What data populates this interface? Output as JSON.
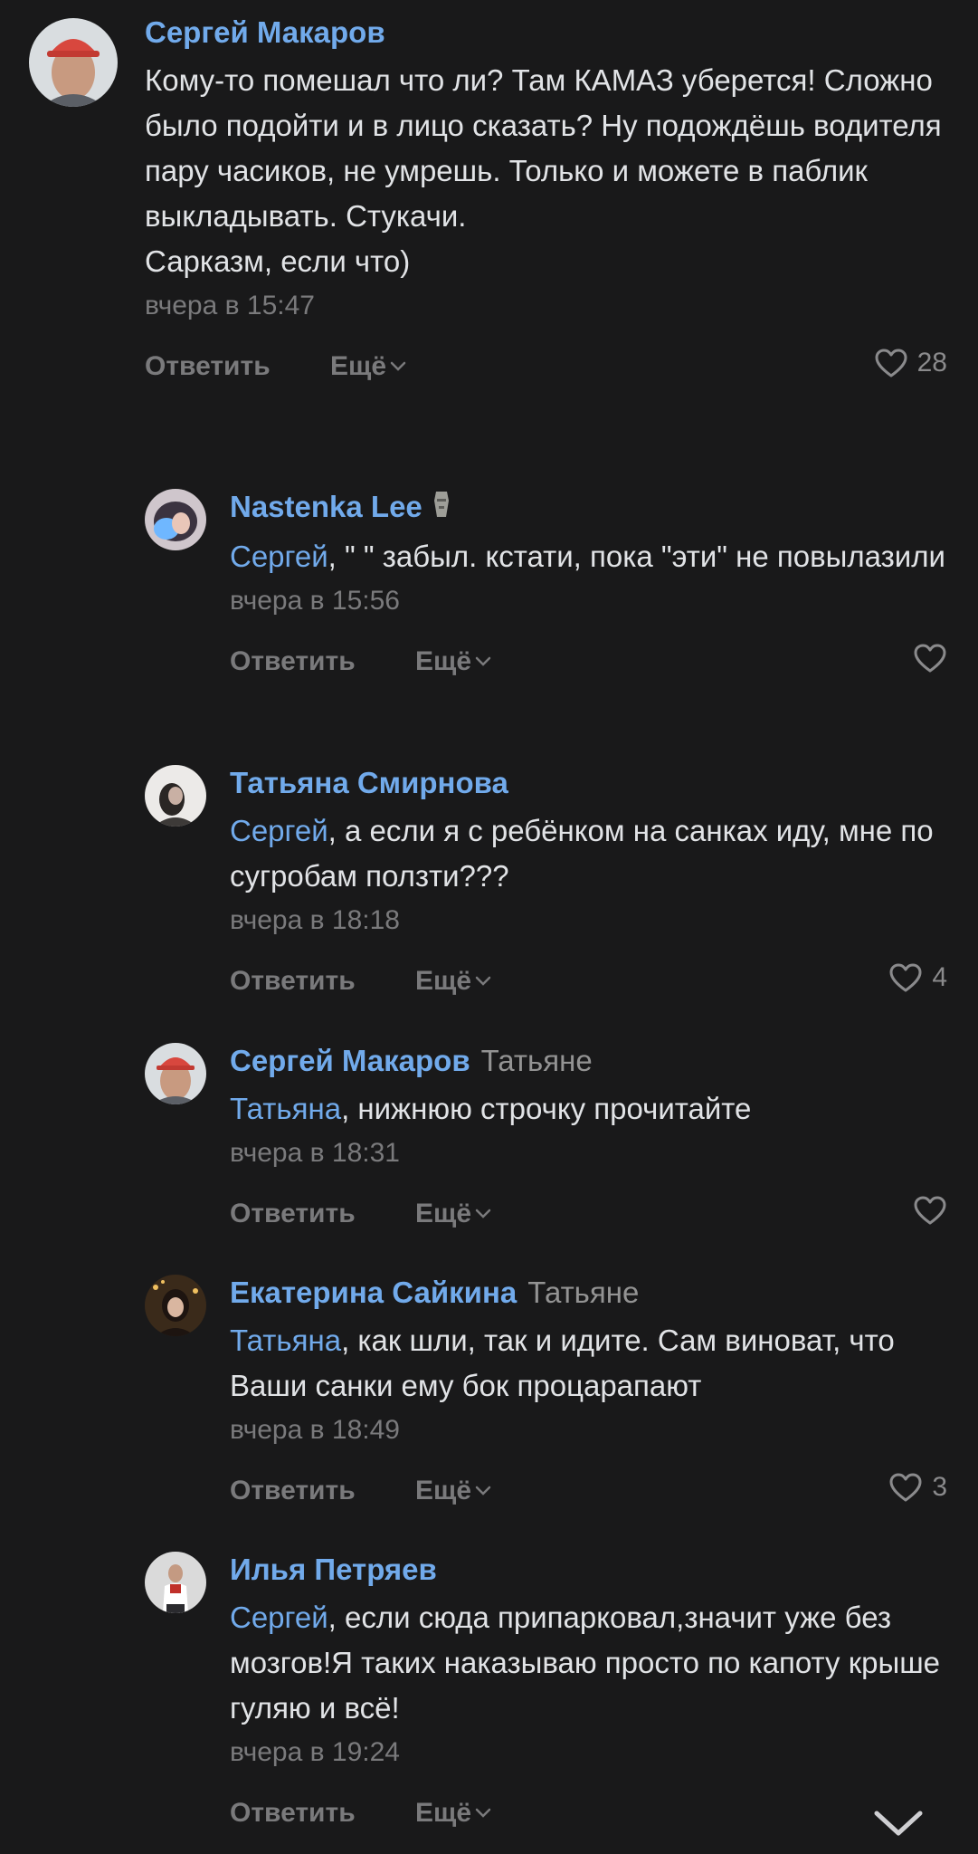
{
  "comments": [
    {
      "author": "Сергей Макаров",
      "reply_to": "",
      "mention": "",
      "text": "Кому-то помешал что ли? Там КАМАЗ уберется! Сложно было подойти и в лицо сказать? Ну подождёшь водителя пару часиков, не умрешь. Только и можете в паблик выкладывать. Стукачи.\nСарказм, если что)",
      "time": "вчера в 15:47",
      "reply_label": "Ответить",
      "more_label": "Ещё",
      "likes": "28"
    },
    {
      "author": "Nastenka Lee",
      "reply_to": "",
      "mention": "Сергей",
      "text": ", \" \" забыл. кстати, пока \"эти\" не повылазили",
      "time": "вчера в 15:56",
      "reply_label": "Ответить",
      "more_label": "Ещё",
      "likes": ""
    },
    {
      "author": "Татьяна Смирнова",
      "reply_to": "",
      "mention": "Сергей",
      "text": ", а если я с ребёнком на санках иду, мне по сугробам ползти???",
      "time": "вчера в 18:18",
      "reply_label": "Ответить",
      "more_label": "Ещё",
      "likes": "4"
    },
    {
      "author": "Сергей Макаров",
      "reply_to": "Татьяне",
      "mention": "Татьяна",
      "text": ", нижнюю строчку прочитайте",
      "time": "вчера в 18:31",
      "reply_label": "Ответить",
      "more_label": "Ещё",
      "likes": ""
    },
    {
      "author": "Екатерина Сайкина",
      "reply_to": "Татьяне",
      "mention": "Татьяна",
      "text": ", как шли, так и идите. Сам виноват, что Ваши санки ему бок процарапают",
      "time": "вчера в 18:49",
      "reply_label": "Ответить",
      "more_label": "Ещё",
      "likes": "3"
    },
    {
      "author": "Илья Петряев",
      "reply_to": "",
      "mention": "Сергей",
      "text": ", если сюда припарковал,значит уже без мозгов!Я таких наказываю просто по капоту крыше гуляю и всё!",
      "time": "вчера в 19:24",
      "reply_label": "Ответить",
      "more_label": "Ещё",
      "likes": ""
    }
  ],
  "icons": {
    "like": "heart-outline-icon",
    "more": "chevron-down-icon",
    "scroll": "chevron-down-icon",
    "emoji": "moai-icon"
  },
  "colors": {
    "background": "#19191a",
    "author": "#71aaeb",
    "text": "#e1e3e6",
    "secondary": "#7a7a7c"
  }
}
